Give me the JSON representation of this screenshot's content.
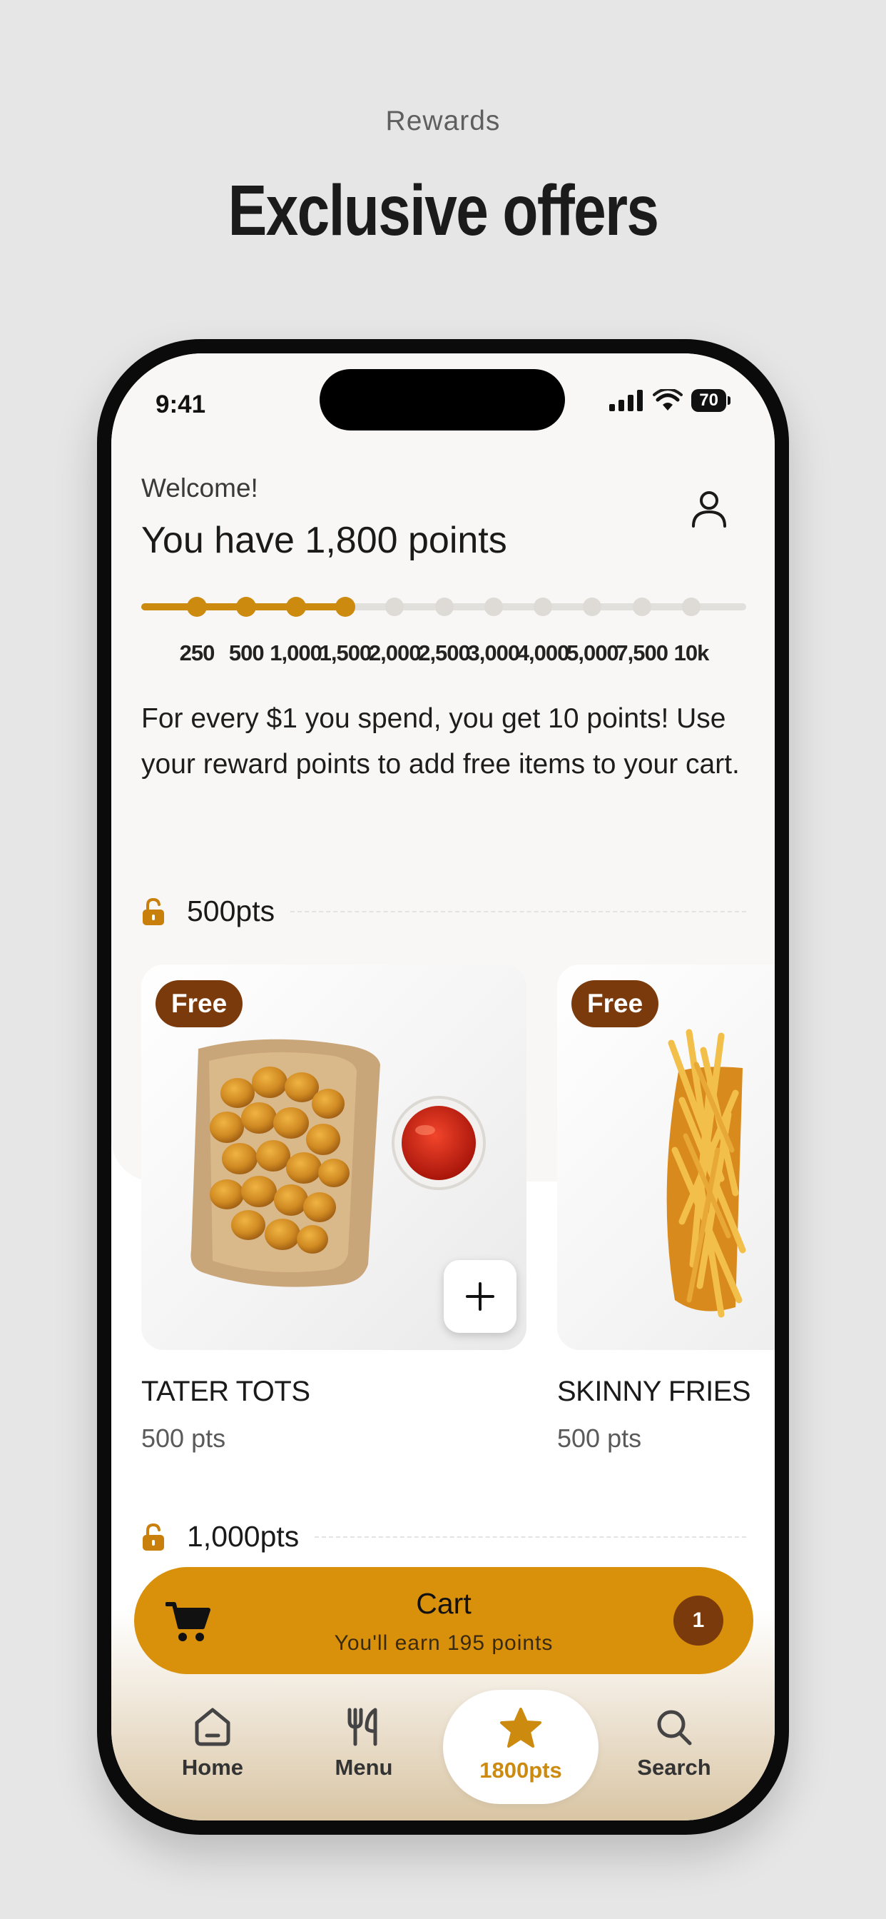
{
  "page": {
    "eyebrow": "Rewards",
    "headline": "Exclusive offers"
  },
  "status_bar": {
    "time": "9:41",
    "battery": "70"
  },
  "header": {
    "welcome": "Welcome!",
    "points_title": "You have 1,800 points",
    "profile_icon": "person-icon"
  },
  "progress": {
    "current_points": 1800,
    "milestones": [
      "250",
      "500",
      "1,000",
      "1,500",
      "2,000",
      "2,500",
      "3,000",
      "4,000",
      "5,000",
      "7,500",
      "10k"
    ],
    "reached_count": 4
  },
  "info_text": "For every $1 you spend, you get 10 points! Use your reward points to add free items to your cart.",
  "sections": [
    {
      "label": "500pts",
      "items": [
        {
          "badge": "Free",
          "name": "TATER TOTS",
          "points": "500 pts",
          "image": "tater-tots-in-tray-with-ketchup"
        },
        {
          "badge": "Free",
          "name": "SKINNY FRIES",
          "points": "500 pts",
          "image": "fries-in-tray"
        }
      ]
    },
    {
      "label": "1,000pts"
    }
  ],
  "cart": {
    "title": "Cart",
    "subtitle": "You'll earn 195 points",
    "count": "1"
  },
  "tabs": [
    {
      "label": "Home",
      "icon": "home-icon"
    },
    {
      "label": "Menu",
      "icon": "utensils-icon"
    },
    {
      "label": "1800pts",
      "icon": "star-icon",
      "active": true
    },
    {
      "label": "Search",
      "icon": "search-icon"
    }
  ],
  "colors": {
    "accent": "#d9900a",
    "accent_dark": "#cc8a0e",
    "badge": "#7a3a0c",
    "background": "#e6e6e6"
  }
}
